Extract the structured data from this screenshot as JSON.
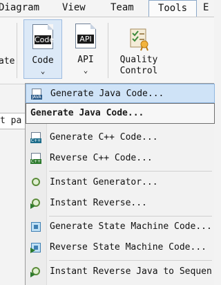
{
  "menubar": {
    "items": [
      {
        "label": "Diagram"
      },
      {
        "label": "View"
      },
      {
        "label": "Team"
      },
      {
        "label": "Tools",
        "active": true
      },
      {
        "label": "E"
      }
    ]
  },
  "ribbon": {
    "partial_label": "ate",
    "code": {
      "icon_text": "Code",
      "label": "Code",
      "chevron": "⌄"
    },
    "api": {
      "icon_text": "API",
      "label": "API",
      "chevron": "⌄"
    },
    "quality": {
      "label_line1": "Quality",
      "label_line2": "Control"
    }
  },
  "background": {
    "field_text": "t pa"
  },
  "menu": {
    "items": [
      {
        "label": "Generate Java Code...",
        "icon": "java-code-icon",
        "icon_tag": "JAVA",
        "highlighted": true
      },
      {
        "label": "Generate C++ Code...",
        "icon": "cpp-code-icon",
        "icon_tag": "C++"
      },
      {
        "label": "Reverse C++ Code...",
        "icon": "cpp-reverse-icon",
        "icon_tag": "C++"
      },
      {
        "label": "Instant Generator...",
        "icon": "instant-generator-icon"
      },
      {
        "label": "Instant Reverse...",
        "icon": "instant-reverse-icon"
      },
      {
        "label": "Generate State Machine Code...",
        "icon": "state-machine-generate-icon"
      },
      {
        "label": "Reverse State Machine Code...",
        "icon": "state-machine-reverse-icon"
      },
      {
        "label": "Instant Reverse Java to Sequen",
        "icon": "java-sequence-icon"
      }
    ],
    "tooltip": "Generate Java Code..."
  },
  "colors": {
    "highlight": "#cfe3f7",
    "selected_button": "#dce9f7"
  }
}
